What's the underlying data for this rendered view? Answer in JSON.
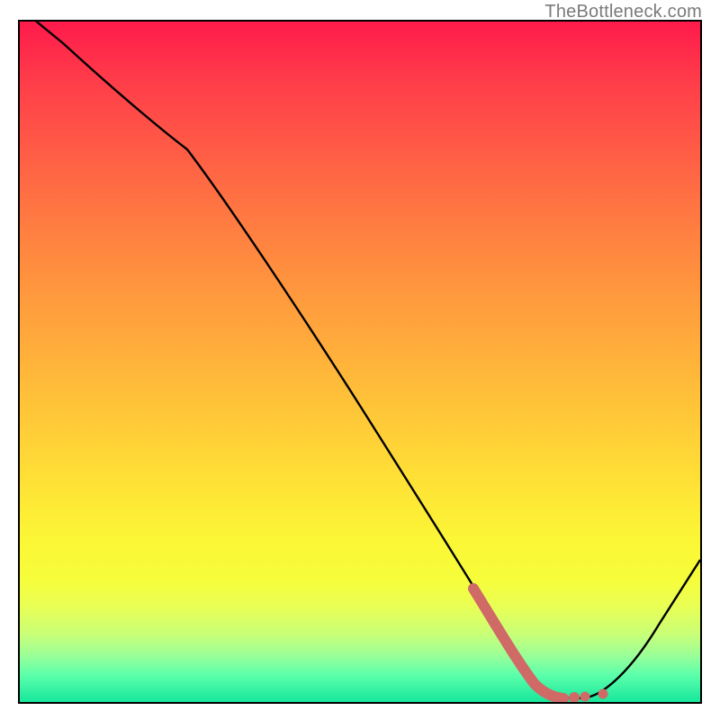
{
  "watermark": {
    "text": "TheBottleneck.com"
  },
  "chart_data": {
    "type": "line",
    "title": "",
    "xlabel": "",
    "ylabel": "",
    "xlim": [
      0,
      100
    ],
    "ylim": [
      0,
      100
    ],
    "grid": false,
    "legend": false,
    "series": [
      {
        "name": "bottleneck-curve",
        "color": "#000000",
        "x": [
          0,
          6,
          24,
          40,
          55,
          68,
          72,
          76,
          80,
          84,
          88,
          100
        ],
        "y": [
          102,
          97,
          82,
          60,
          40,
          20,
          10,
          4,
          1,
          0.5,
          1.5,
          20
        ]
      }
    ],
    "highlight_segment": {
      "name": "highlight-dots",
      "color": "#d06464",
      "x_range": [
        67,
        84
      ],
      "description": "thick coral stroke over trough"
    },
    "gradient_stops": [
      {
        "pos": 0,
        "color": "#ff1a4b"
      },
      {
        "pos": 50,
        "color": "#ffb53a"
      },
      {
        "pos": 80,
        "color": "#f8ff3a"
      },
      {
        "pos": 100,
        "color": "#17e79b"
      }
    ]
  }
}
